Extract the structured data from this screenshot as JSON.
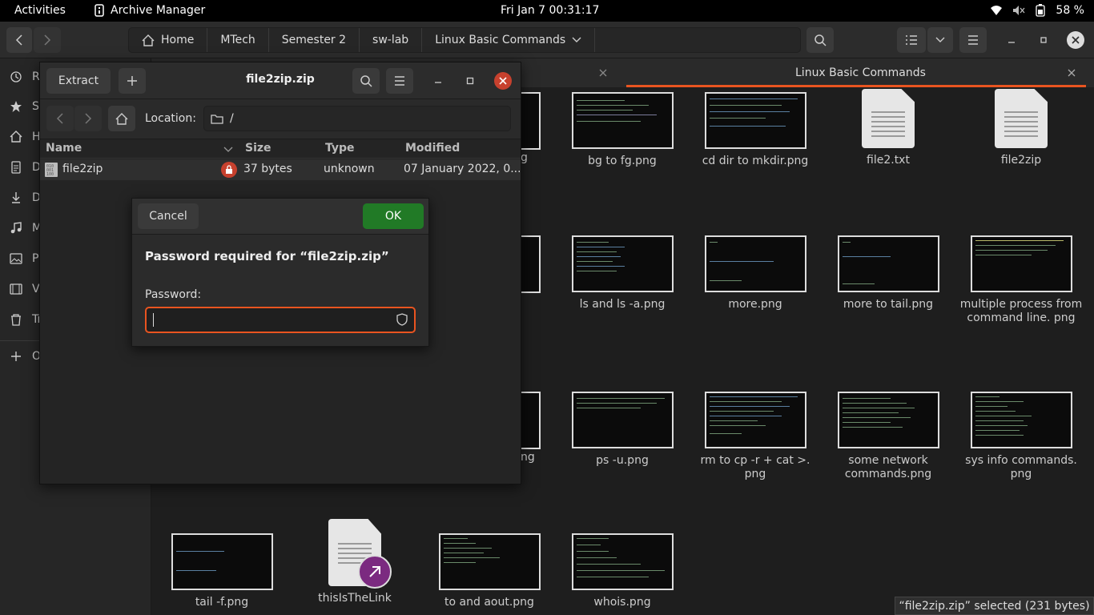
{
  "topbar": {
    "activities": "Activities",
    "app_name": "Archive Manager",
    "clock": "Fri Jan 7  00:31:17",
    "battery": "58 %"
  },
  "files_window": {
    "breadcrumbs": [
      "Home",
      "MTech",
      "Semester 2",
      "sw-lab",
      "Linux Basic Commands"
    ],
    "tab_active": "Linux Basic Commands",
    "sidebar": [
      "Re",
      "St",
      "H",
      "D",
      "D",
      "M",
      "Pi",
      "V",
      "Tr",
      "O"
    ],
    "files": [
      {
        "name": "bg to fg.png"
      },
      {
        "name": "cd dir to mkdir.png"
      },
      {
        "name": "file2.txt"
      },
      {
        "name": "file2zip"
      },
      {
        "name": "ls and ls -a.png"
      },
      {
        "name": "more.png"
      },
      {
        "name": "more to tail.png"
      },
      {
        "name": "multiple process from command line. png"
      },
      {
        "name": "ps -u.png"
      },
      {
        "name": "rm to cp -r + cat >. png"
      },
      {
        "name": "some network commands.png"
      },
      {
        "name": "sys info commands. png"
      },
      {
        "name": "tail -f.png"
      },
      {
        "name": "thisIsTheLink"
      },
      {
        "name": "to and aout.png"
      },
      {
        "name": "whois.png"
      }
    ],
    "partial_labels": [
      "g",
      "ng"
    ],
    "status": "“file2zip.zip” selected  (231 bytes)"
  },
  "archive_manager": {
    "extract_label": "Extract",
    "title": "file2zip.zip",
    "location_label": "Location:",
    "location_value": "/",
    "columns": {
      "name": "Name",
      "size": "Size",
      "type": "Type",
      "modified": "Modified"
    },
    "row": {
      "name": "file2zip",
      "size": "37 bytes",
      "type": "unknown",
      "modified": "07 January 2022, 0..."
    }
  },
  "dialog": {
    "cancel": "Cancel",
    "ok": "OK",
    "heading": "Password required for “file2zip.zip”",
    "password_label": "Password:",
    "password_value": ""
  },
  "colors": {
    "accent_orange": "#e95420",
    "ok_green": "#217a26",
    "close_red": "#c7412e"
  }
}
